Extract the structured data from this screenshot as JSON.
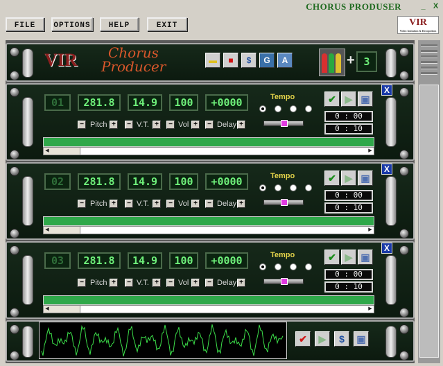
{
  "app": {
    "title": "CHORUS PRODUSER",
    "min_icon": "minimize-icon",
    "close_icon": "close-icon"
  },
  "menu": {
    "file": "FILE",
    "options": "OPTIONS",
    "help": "HELP",
    "exit": "EXIT"
  },
  "logo": {
    "small_text": "VIR",
    "small_sub": "Video Imitation & Recognition",
    "big_text": "VIR",
    "product_name_1": "Chorus",
    "product_name_2": "Producer"
  },
  "header": {
    "tools": [
      "folder-icon",
      "stop-icon",
      "dollar-icon",
      "g-icon",
      "a-icon"
    ],
    "voices_plus": "+",
    "voices_count": "3"
  },
  "labels": {
    "pitch": "Pitch",
    "vt": "V.T.",
    "vol": "Vol",
    "delay": "Delay",
    "tempo": "Tempo",
    "minus": "−",
    "plus": "+",
    "close": "X"
  },
  "tracks": [
    {
      "number": "01",
      "pitch": "281.8",
      "vt": "14.9",
      "vol": "100",
      "delay": "+0000",
      "time1": "0 : 00",
      "time2": "0 : 10"
    },
    {
      "number": "02",
      "pitch": "281.8",
      "vt": "14.9",
      "vol": "100",
      "delay": "+0000",
      "time1": "0 : 00",
      "time2": "0 : 10"
    },
    {
      "number": "03",
      "pitch": "281.8",
      "vt": "14.9",
      "vol": "100",
      "delay": "+0000",
      "time1": "0 : 00",
      "time2": "0 : 10"
    }
  ],
  "colors": {
    "lcd": "#6ef07a",
    "track": "#2fa84a",
    "tempo": "#e2d24a",
    "brand_red": "#8a1e1e"
  }
}
